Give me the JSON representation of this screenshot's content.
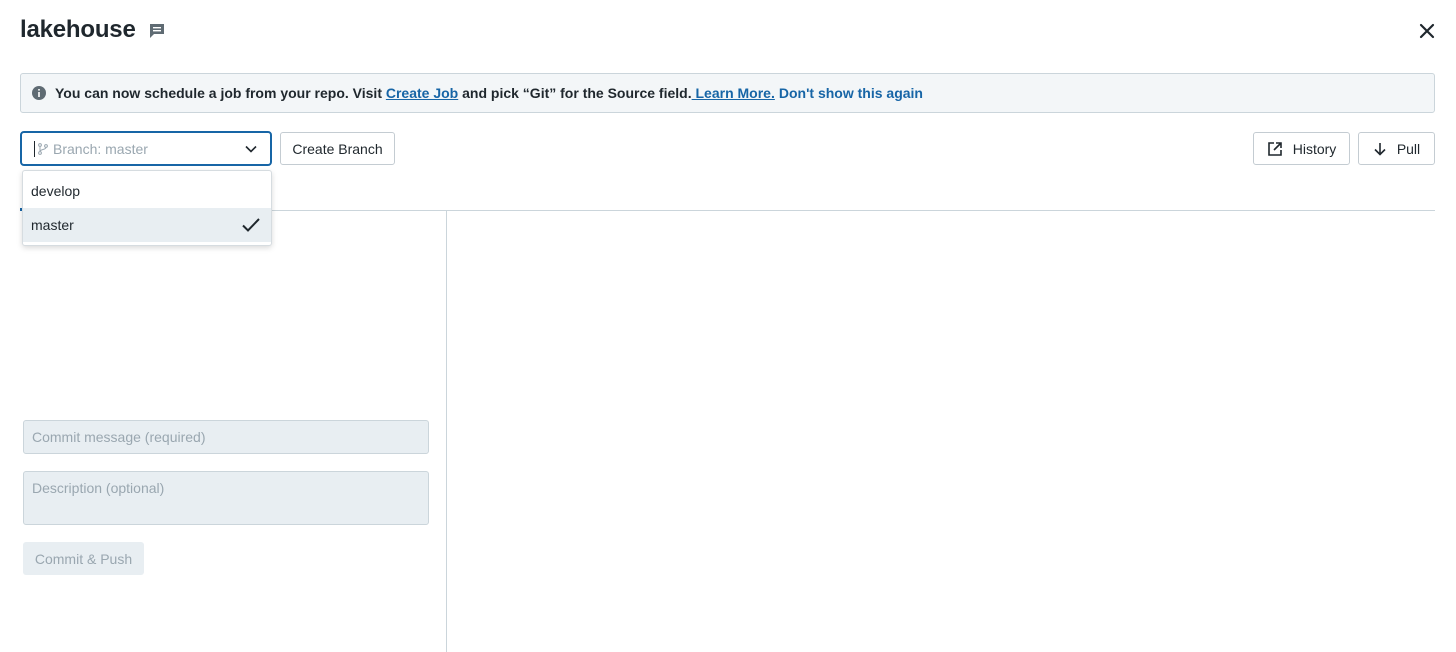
{
  "header": {
    "title": "lakehouse",
    "comment_icon": "comment-icon",
    "close_icon": "close-icon"
  },
  "banner": {
    "icon": "info-icon",
    "text_before": "You can now schedule a job from your repo. Visit ",
    "create_job_link": "Create Job",
    "text_middle": " and pick “Git” for the Source field.",
    "learn_more_link": " Learn More.",
    "dont_show_link": "Don't show this again"
  },
  "branch_select": {
    "placeholder": "Branch: master",
    "options": [
      {
        "label": "develop",
        "selected": false
      },
      {
        "label": "master",
        "selected": true
      }
    ]
  },
  "toolbar": {
    "create_branch": "Create Branch",
    "history": "History",
    "pull": "Pull"
  },
  "commit": {
    "message_placeholder": "Commit message (required)",
    "description_placeholder": "Description (optional)",
    "commit_push_label": "Commit & Push"
  },
  "colors": {
    "accent": "#1765a6",
    "banner_bg": "#f3f6f8",
    "disabled_bg": "#e8eef2",
    "disabled_text": "#9aa7b0"
  }
}
